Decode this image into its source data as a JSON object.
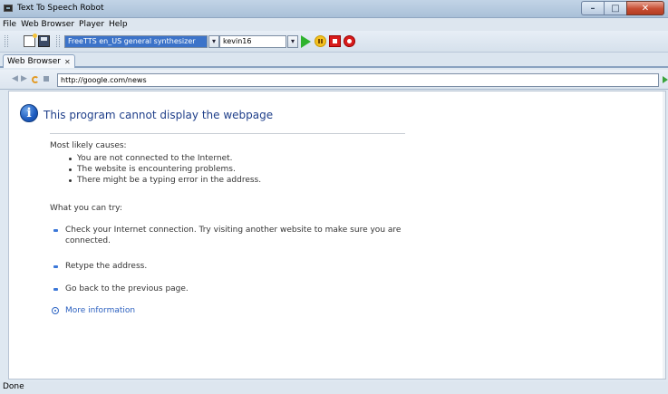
{
  "window": {
    "title": "Text To Speech Robot"
  },
  "menu": [
    "File",
    "Web Browser",
    "Player",
    "Help"
  ],
  "toolbar": {
    "synthesizer": "FreeTTS en_US general synthesizer",
    "voice": "kevin16"
  },
  "tabs": [
    {
      "label": "Web Browser"
    }
  ],
  "address": {
    "url": "http://google.com/news"
  },
  "error_page": {
    "title": "This program cannot display the webpage",
    "causes_heading": "Most likely causes:",
    "causes": [
      "You are not connected to the Internet.",
      "The website is encountering problems.",
      "There might be a typing error in the address."
    ],
    "try_heading": "What you can try:",
    "try_items": [
      "Check your Internet connection. Try visiting another website to make sure you are connected.",
      "Retype the address.",
      "Go back to the previous page."
    ],
    "more_info": "More information"
  },
  "status": {
    "text": "Done"
  },
  "colors": {
    "link": "#2a5fbf",
    "title": "#1f3f8a",
    "accent": "#3c73c9"
  }
}
